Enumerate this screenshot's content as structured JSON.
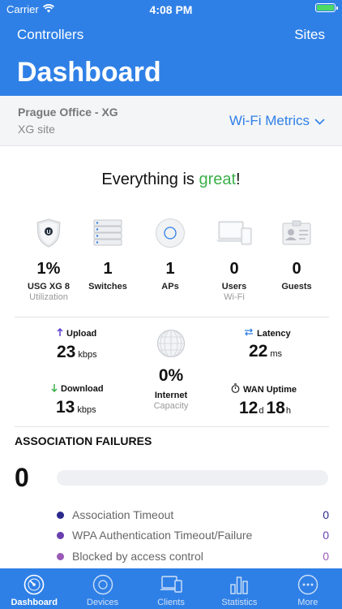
{
  "status": {
    "carrier": "Carrier",
    "time": "4:08 PM"
  },
  "nav": {
    "left": "Controllers",
    "right": "Sites",
    "title": "Dashboard"
  },
  "site": {
    "name": "Prague Office - XG",
    "subtitle": "XG site",
    "metrics_label": "Wi-Fi Metrics"
  },
  "headline": {
    "prefix": "Everything is ",
    "status": "great",
    "suffix": "!"
  },
  "stats": [
    {
      "value": "1%",
      "label": "USG XG 8",
      "sub": "Utilization",
      "icon": "usg-shield-icon"
    },
    {
      "value": "1",
      "label": "Switches",
      "sub": "",
      "icon": "switch-icon"
    },
    {
      "value": "1",
      "label": "APs",
      "sub": "",
      "icon": "access-point-icon"
    },
    {
      "value": "0",
      "label": "Users",
      "sub": "Wi-Fi",
      "icon": "devices-icon"
    },
    {
      "value": "0",
      "label": "Guests",
      "sub": "",
      "icon": "guest-badge-icon"
    }
  ],
  "throughput": {
    "upload": {
      "label": "Upload",
      "value": "23",
      "unit": "kbps"
    },
    "download": {
      "label": "Download",
      "value": "13",
      "unit": "kbps"
    },
    "latency": {
      "label": "Latency",
      "value": "22",
      "unit": "ms"
    },
    "uptime": {
      "label": "WAN Uptime",
      "days": "12",
      "days_unit": "d",
      "hours": "18",
      "hours_unit": "h"
    },
    "internet": {
      "value": "0%",
      "label": "Internet",
      "sub": "Capacity"
    }
  },
  "association": {
    "title": "ASSOCIATION FAILURES",
    "count": "0",
    "items": [
      {
        "label": "Association Timeout",
        "value": "0",
        "color": "#2b2a8c"
      },
      {
        "label": "WPA Authentication Timeout/Failure",
        "value": "0",
        "color": "#6a3fb0"
      },
      {
        "label": "Blocked by access control",
        "value": "0",
        "color": "#9b59b6"
      }
    ]
  },
  "tabs": [
    {
      "label": "Dashboard",
      "icon": "dashboard-icon",
      "active": true
    },
    {
      "label": "Devices",
      "icon": "devices-tab-icon"
    },
    {
      "label": "Clients",
      "icon": "clients-icon"
    },
    {
      "label": "Statistics",
      "icon": "statistics-icon"
    },
    {
      "label": "More",
      "icon": "more-icon"
    }
  ],
  "colors": {
    "accent": "#2f80e6",
    "great": "#3cb04a",
    "upload": "#5b3fd0",
    "download": "#3cb04a"
  }
}
